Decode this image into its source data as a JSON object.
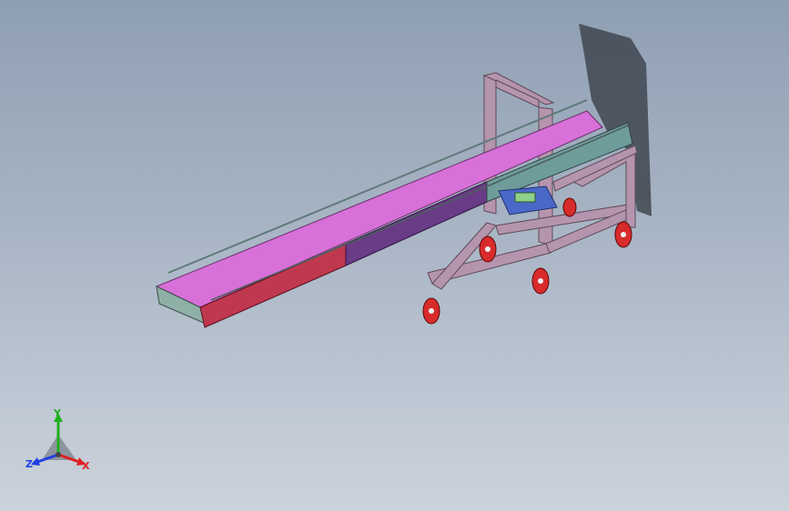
{
  "viewport": {
    "background_top": "#8f9fb3",
    "background_bottom": "#cbd2db"
  },
  "model": {
    "belt_color": "#d770d8",
    "frame_color": "#b594ad",
    "side_rail_red": "#c0384f",
    "side_rail_purple": "#6a3b86",
    "side_rail_teal": "#6e9c9a",
    "wheel_color": "#d82b2b",
    "shadow_color": "#3f4650"
  },
  "triad": {
    "x_label": "X",
    "y_label": "Y",
    "z_label": "Z",
    "x_color": "#e02020",
    "y_color": "#20b020",
    "z_color": "#2040e0"
  }
}
